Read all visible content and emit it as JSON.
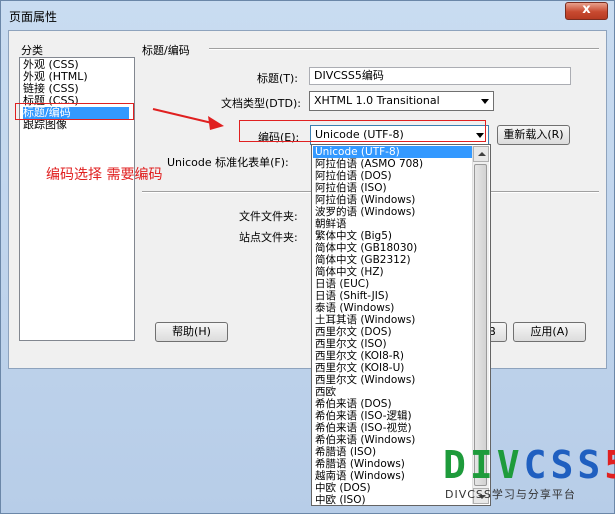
{
  "window": {
    "title": "页面属性",
    "close_label": "x"
  },
  "category": {
    "label": "分类",
    "items": [
      {
        "label": "外观 (CSS)"
      },
      {
        "label": "外观 (HTML)"
      },
      {
        "label": "链接 (CSS)"
      },
      {
        "label": "标题 (CSS)"
      },
      {
        "label": "标题/编码"
      },
      {
        "label": "跟踪图像"
      }
    ],
    "selected_index": 4
  },
  "section": {
    "title": "标题/编码"
  },
  "fields": {
    "title_label": "标题(T):",
    "title_value": "DIVCSS5编码",
    "doctype_label": "文档类型(DTD):",
    "doctype_value": "XHTML 1.0 Transitional",
    "encoding_label": "编码(E):",
    "encoding_value": "Unicode (UTF-8)",
    "reload_label": "重新载入(R)",
    "unicode_form_label": "Unicode 标准化表单(F):",
    "doc_folder_label": "文件文件夹:",
    "site_folder_label": "站点文件夹:"
  },
  "buttons": {
    "help": "帮助(H)",
    "partial": "B",
    "apply": "应用(A)"
  },
  "dropdown": {
    "items": [
      "Unicode (UTF-8)",
      "阿拉伯语 (ASMO 708)",
      "阿拉伯语 (DOS)",
      "阿拉伯语 (ISO)",
      "阿拉伯语 (Windows)",
      "波罗的语 (Windows)",
      "朝鲜语",
      "繁体中文 (Big5)",
      "简体中文 (GB18030)",
      "简体中文 (GB2312)",
      "简体中文 (HZ)",
      "日语 (EUC)",
      "日语 (Shift-JIS)",
      "泰语 (Windows)",
      "土耳其语 (Windows)",
      "西里尔文 (DOS)",
      "西里尔文 (ISO)",
      "西里尔文 (KOI8-R)",
      "西里尔文 (KOI8-U)",
      "西里尔文 (Windows)",
      "西欧",
      "希伯来语 (DOS)",
      "希伯来语 (ISO-逻辑)",
      "希伯来语 (ISO-视觉)",
      "希伯来语 (Windows)",
      "希腊语 (ISO)",
      "希腊语 (Windows)",
      "越南语 (Windows)",
      "中欧 (DOS)",
      "中欧 (ISO)"
    ],
    "selected_index": 0
  },
  "annotation": {
    "text": "编码选择 需要编码",
    "color": "#e02020"
  },
  "watermark": {
    "logo_parts": [
      {
        "text": "DIV",
        "color": "#1e9b3b"
      },
      {
        "text": "CSS",
        "color": "#1f5fc0"
      },
      {
        "text": "5",
        "color": "#e02020"
      }
    ],
    "subtitle": "DIVCSS学习与分享平台"
  }
}
